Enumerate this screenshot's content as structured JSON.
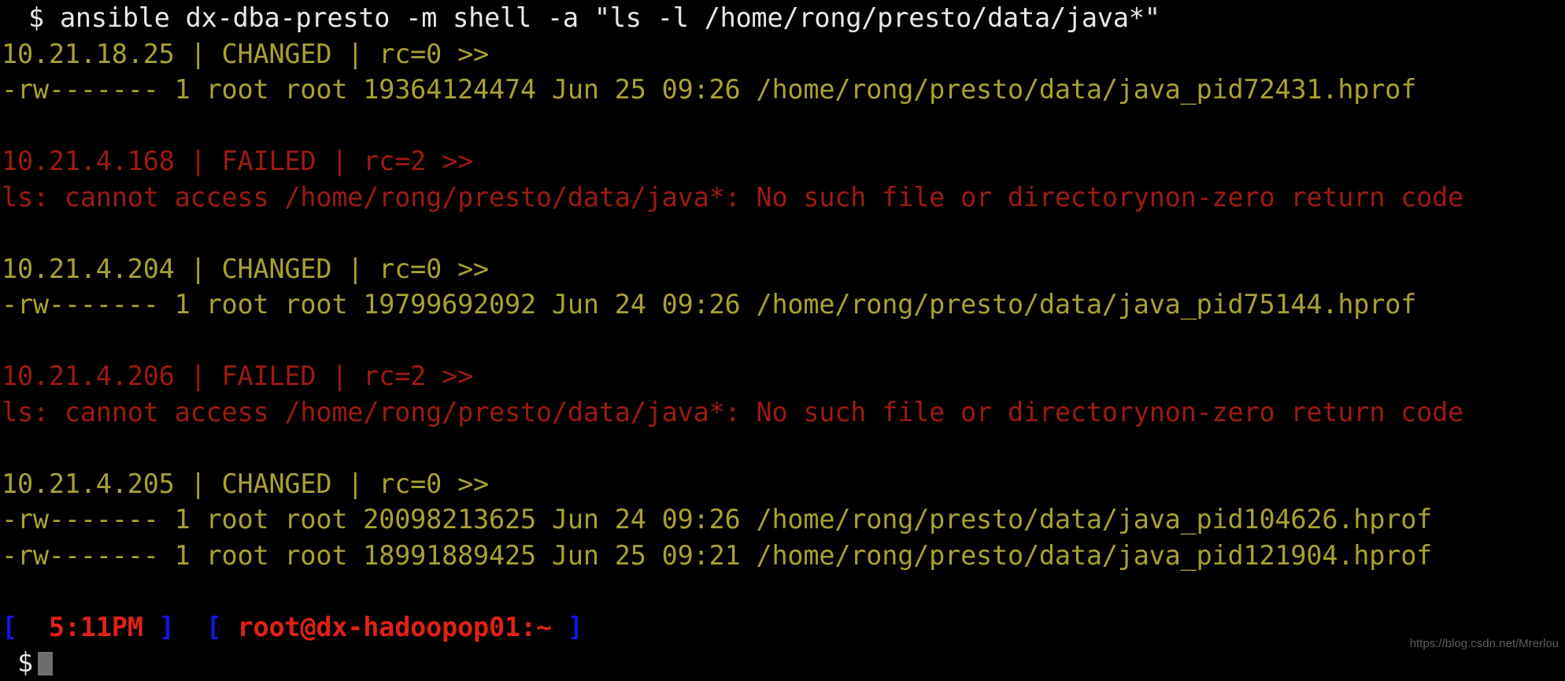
{
  "terminal": {
    "background_color": "#000000",
    "colors": {
      "command_text": "#e8e8e8",
      "changed": "#a8a132",
      "failed": "#9c1b12",
      "prompt_bracket": "#1414e0",
      "prompt_text": "#e02118",
      "cursor": "#6e6e6e"
    },
    "command": {
      "sigil": "$",
      "text": "ansible dx-dba-presto -m shell -a \"ls -l /home/rong/presto/data/java*\""
    },
    "blocks": [
      {
        "host": "10.21.18.25",
        "status": "CHANGED",
        "rc": "rc=0",
        "arrow": ">>",
        "header": "10.21.18.25 | CHANGED | rc=0 >>",
        "color": "changed",
        "lines": [
          "-rw------- 1 root root 19364124474 Jun 25 09:26 /home/rong/presto/data/java_pid72431.hprof"
        ]
      },
      {
        "host": "10.21.4.168",
        "status": "FAILED",
        "rc": "rc=2",
        "arrow": ">>",
        "header": "10.21.4.168 | FAILED | rc=2 >>",
        "color": "failed",
        "lines": [
          "ls: cannot access /home/rong/presto/data/java*: No such file or directorynon-zero return code"
        ]
      },
      {
        "host": "10.21.4.204",
        "status": "CHANGED",
        "rc": "rc=0",
        "arrow": ">>",
        "header": "10.21.4.204 | CHANGED | rc=0 >>",
        "color": "changed",
        "lines": [
          "-rw------- 1 root root 19799692092 Jun 24 09:26 /home/rong/presto/data/java_pid75144.hprof"
        ]
      },
      {
        "host": "10.21.4.206",
        "status": "FAILED",
        "rc": "rc=2",
        "arrow": ">>",
        "header": "10.21.4.206 | FAILED | rc=2 >>",
        "color": "failed",
        "lines": [
          "ls: cannot access /home/rong/presto/data/java*: No such file or directorynon-zero return code"
        ]
      },
      {
        "host": "10.21.4.205",
        "status": "CHANGED",
        "rc": "rc=0",
        "arrow": ">>",
        "header": "10.21.4.205 | CHANGED | rc=0 >>",
        "color": "changed",
        "lines": [
          "-rw------- 1 root root 20098213625 Jun 24 09:26 /home/rong/presto/data/java_pid104626.hprof",
          "-rw------- 1 root root 18991889425 Jun 25 09:21 /home/rong/presto/data/java_pid121904.hprof"
        ]
      }
    ],
    "prompt": {
      "open_bracket_1": "[",
      "time": "5:11PM",
      "close_bracket_1": "]",
      "open_bracket_2": "[",
      "user_host": "root@dx-hadoopop01:~",
      "close_bracket_2": "]",
      "sigil": "$"
    }
  },
  "watermark": {
    "text": "https://blog.csdn.net/Mrerlou"
  }
}
